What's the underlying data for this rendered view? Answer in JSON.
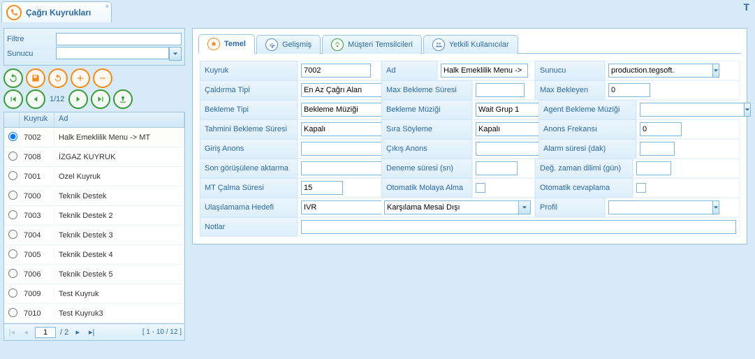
{
  "top_right_letter": "T",
  "main_tab": {
    "title": "Çağrı Kuyrukları",
    "close": "×"
  },
  "filter": {
    "filtre_label": "Filtre",
    "filtre_value": "",
    "sunucu_label": "Sunucu",
    "sunucu_value": ""
  },
  "toolbar": {
    "page_indicator": "1/12",
    "icons": {
      "refresh": "refresh",
      "save": "save",
      "reload": "reload",
      "add": "add",
      "remove": "remove",
      "first": "first",
      "prev": "prev",
      "next": "next",
      "last": "last",
      "export": "export"
    }
  },
  "grid": {
    "headers": {
      "kuyruk": "Kuyruk",
      "ad": "Ad"
    },
    "rows": [
      {
        "selected": true,
        "kuyruk": "7002",
        "ad": "Halk Emeklilik Menu -> MT"
      },
      {
        "selected": false,
        "kuyruk": "7008",
        "ad": "İZGAZ KUYRUK"
      },
      {
        "selected": false,
        "kuyruk": "7001",
        "ad": "Ozel Kuyruk"
      },
      {
        "selected": false,
        "kuyruk": "7000",
        "ad": "Teknik Destek"
      },
      {
        "selected": false,
        "kuyruk": "7003",
        "ad": "Teknik Destek 2"
      },
      {
        "selected": false,
        "kuyruk": "7004",
        "ad": "Teknik Destek 3"
      },
      {
        "selected": false,
        "kuyruk": "7005",
        "ad": "Teknik Destek 4"
      },
      {
        "selected": false,
        "kuyruk": "7006",
        "ad": "Teknik Destek 5"
      },
      {
        "selected": false,
        "kuyruk": "7009",
        "ad": "Test Kuyruk"
      },
      {
        "selected": false,
        "kuyruk": "7010",
        "ad": "Test Kuyruk3"
      }
    ]
  },
  "pager": {
    "page": "1",
    "total": "/ 2",
    "range": "[ 1 - 10 / 12 ]"
  },
  "tabs": {
    "temel": "Temel",
    "gelismis": "Gelişmiş",
    "mt": "Müşteri Temsilcileri",
    "yetkili": "Yetkili Kullanıcılar"
  },
  "form": {
    "kuyruk": {
      "label": "Kuyruk",
      "value": "7002"
    },
    "ad": {
      "label": "Ad",
      "value": "Halk Emeklilik Menu ->"
    },
    "sunucu": {
      "label": "Sunucu",
      "value": "production.tegsoft."
    },
    "caldirma_tipi": {
      "label": "Çaldırma Tipi",
      "value": "En Az Çağrı Alan"
    },
    "max_bekleme_suresi": {
      "label": "Max Bekleme Süresi",
      "value": ""
    },
    "max_bekleyen": {
      "label": "Max Bekleyen",
      "value": "0"
    },
    "bekleme_tipi": {
      "label": "Bekleme Tipi",
      "value": "Bekleme Müziği"
    },
    "bekleme_muzigi": {
      "label": "Bekleme Müziği",
      "value": "Wait Grup 1"
    },
    "agent_bekleme_muzigi": {
      "label": "Agent Bekleme Müziği",
      "value": ""
    },
    "tahmini_bekleme": {
      "label": "Tahmini Bekleme Süresi",
      "value": "Kapalı"
    },
    "sira_soyleme": {
      "label": "Sıra Söyleme",
      "value": "Kapalı"
    },
    "anons_frekansi": {
      "label": "Anons Frekansı",
      "value": "0"
    },
    "giris_anons": {
      "label": "Giriş Anons",
      "value": ""
    },
    "cikis_anons": {
      "label": "Çıkış Anons",
      "value": ""
    },
    "alarm_sure": {
      "label": "Alarm süresi (dak)",
      "value": ""
    },
    "son_gorusulene": {
      "label": "Son görüşülene aktarma",
      "value": ""
    },
    "deneme_sure": {
      "label": "Deneme süresi (sn)",
      "value": ""
    },
    "deg_zaman": {
      "label": "Değ. zaman dilimi (gün)",
      "value": ""
    },
    "mt_calma": {
      "label": "MT Çalma Süresi",
      "value": "15"
    },
    "otomatik_molaya": {
      "label": "Otomatik Molaya Alma",
      "value": false
    },
    "otomatik_cevap": {
      "label": "Otomatik cevaplama",
      "value": false
    },
    "ulasilamama": {
      "label": "Ulaşılamama Hedefi",
      "value1": "IVR",
      "value2": "Karşılama Mesai Dışı"
    },
    "profil": {
      "label": "Profil",
      "value": ""
    },
    "notlar": {
      "label": "Notlar",
      "value": ""
    }
  }
}
